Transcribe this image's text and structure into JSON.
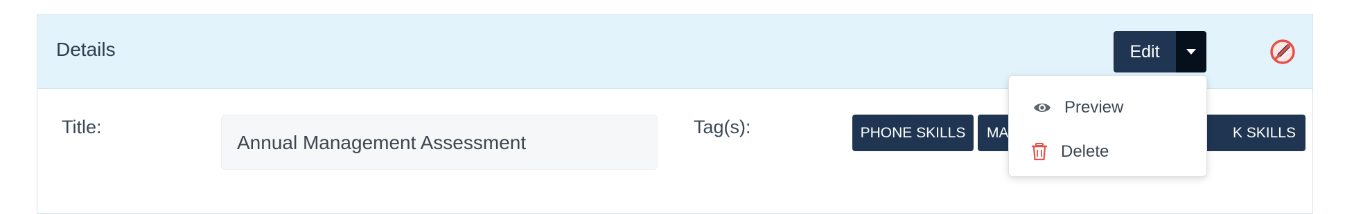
{
  "panel": {
    "title": "Details",
    "edit_label": "Edit"
  },
  "form": {
    "title_label": "Title:",
    "title_value": "Annual Management Assessment",
    "tags_label": "Tag(s):",
    "tags": [
      "PHONE SKILLS",
      "MA",
      "K SKILLS"
    ]
  },
  "dropdown": {
    "items": [
      {
        "label": "Preview",
        "icon": "eye-icon"
      },
      {
        "label": "Delete",
        "icon": "trash-icon"
      }
    ]
  },
  "colors": {
    "header_bg": "#e3f3fb",
    "button_bg": "#1f3552",
    "danger": "#e4504a"
  }
}
